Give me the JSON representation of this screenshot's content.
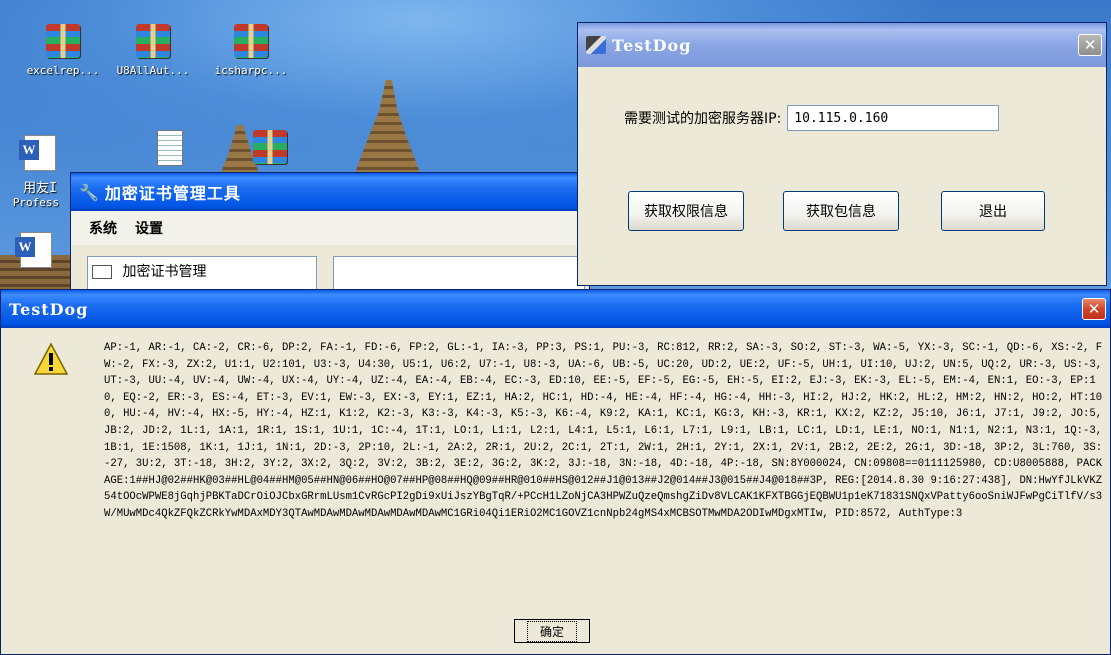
{
  "desktop": {
    "icons": [
      {
        "label": "excelrep..."
      },
      {
        "label": "U8AllAut..."
      },
      {
        "label": "icsharpc..."
      },
      {
        "label": "用友I"
      },
      {
        "label": "Profess"
      }
    ]
  },
  "cert_window": {
    "title": "加密证书管理工具",
    "menu": [
      "系统",
      "设置"
    ],
    "tree_item": "加密证书管理"
  },
  "testdog_window": {
    "title": "TestDog",
    "ip_label": "需要测试的加密服务器IP:",
    "ip_value": "10.115.0.160",
    "buttons": {
      "permission": "获取权限信息",
      "package": "获取包信息",
      "exit": "退出"
    }
  },
  "message_dialog": {
    "title": "TestDog",
    "message": "AP:-1, AR:-1, CA:-2, CR:-6, DP:2, FA:-1, FD:-6, FP:2, GL:-1, IA:-3, PP:3, PS:1, PU:-3, RC:812, RR:2, SA:-3, SO:2, ST:-3, WA:-5, YX:-3, SC:-1, QD:-6, XS:-2, FW:-2, FX:-3, ZX:2, U1:1, U2:101, U3:-3, U4:30, U5:1, U6:2, U7:-1, U8:-3, UA:-6, UB:-5, UC:20, UD:2, UE:2, UF:-5, UH:1, UI:10, UJ:2, UN:5, UQ:2, UR:-3, US:-3, UT:-3, UU:-4, UV:-4, UW:-4, UX:-4, UY:-4, UZ:-4, EA:-4, EB:-4, EC:-3, ED:10, EE:-5, EF:-5, EG:-5, EH:-5, EI:2, EJ:-3, EK:-3, EL:-5, EM:-4, EN:1, EO:-3, EP:10, EQ:-2, ER:-3, ES:-4, ET:-3, EV:1, EW:-3, EX:-3, EY:1, EZ:1, HA:2, HC:1, HD:-4, HE:-4, HF:-4, HG:-4, HH:-3, HI:2, HJ:2, HK:2, HL:2, HM:2, HN:2, HO:2, HT:100, HU:-4, HV:-4, HX:-5, HY:-4, HZ:1, K1:2, K2:-3, K3:-3, K4:-3, K5:-3, K6:-4, K9:2, KA:1, KC:1, KG:3, KH:-3, KR:1, KX:2, KZ:2, J5:10, J6:1, J7:1, J9:2, JO:5, JB:2, JD:2, 1L:1, 1A:1, 1R:1, 1S:1, 1U:1, 1C:-4, 1T:1, LO:1, L1:1, L2:1, L4:1, L5:1, L6:1, L7:1, L9:1, LB:1, LC:1, LD:1, LE:1, NO:1, N1:1, N2:1, N3:1, 1Q:-3, 1B:1, 1E:1508, 1K:1, 1J:1, 1N:1, 2D:-3, 2P:10, 2L:-1, 2A:2, 2R:1, 2U:2, 2C:1, 2T:1, 2W:1, 2H:1, 2Y:1, 2X:1, 2V:1, 2B:2, 2E:2, 2G:1, 3D:-18, 3P:2, 3L:760, 3S:-27, 3U:2, 3T:-18, 3H:2, 3Y:2, 3X:2, 3Q:2, 3V:2, 3B:2, 3E:2, 3G:2, 3K:2, 3J:-18, 3N:-18, 4D:-18, 4P:-18, SN:8Y000024, CN:09808==0111125980, CD:U8005888, PACKAGE:1##HJ@02##HK@03##HL@04##HM@05##HN@06##HO@07##HP@08##HQ@09##HR@010##HS@012##J1@013##J2@014##J3@015##J4@018##3P, REG:[2014.8.30 9:16:27:438], DN:HwYfJLkVKZ54tOOcWPWE8jGqhjPBKTaDCrOiOJCbxGRrmLUsm1CvRGcPI2gDi9xUiJszYBgTqR/+PCcH1LZoNjCA3HPWZuQzeQmshgZiDv8VLCAK1KFXTBGGjEQBWU1p1eK71831SNQxVPatty6ooSniWJFwPgCiTlfV/s3W/MUwMDc4QkZFQkZCRkYwMDAxMDY3QTAwMDAwMDAwMDAwMDAwMDAwMC1GRi04Qi1ERiO2MC1GOVZ1cnNpb24gMS4xMCBSOTMwMDA2ODIwMDgxMTIw, PID:8572, AuthType:3",
    "ok_label": "确定"
  }
}
